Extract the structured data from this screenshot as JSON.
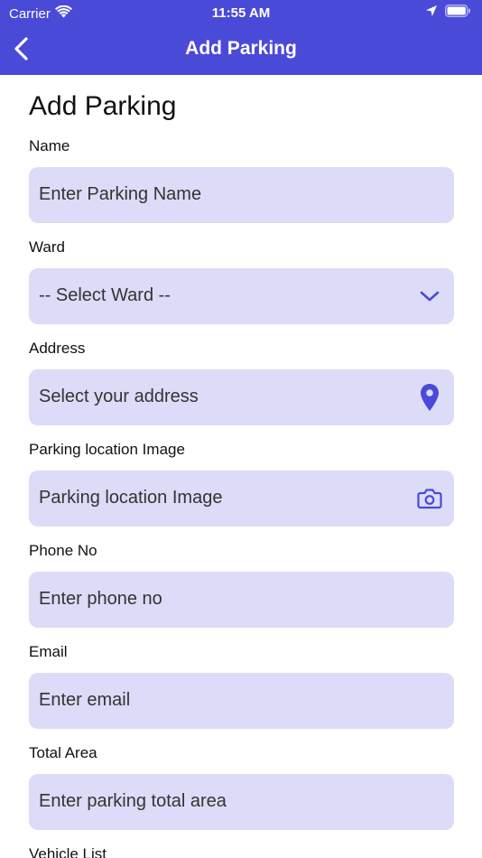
{
  "status_bar": {
    "carrier": "Carrier",
    "time": "11:55 AM"
  },
  "nav": {
    "title": "Add Parking"
  },
  "page": {
    "title": "Add Parking"
  },
  "form": {
    "fields": [
      {
        "label": "Name",
        "placeholder": "Enter Parking Name"
      },
      {
        "label": "Ward",
        "placeholder": "-- Select Ward --",
        "icon": "chevron-down-icon"
      },
      {
        "label": "Address",
        "placeholder": "Select your address",
        "icon": "location-pin-icon"
      },
      {
        "label": "Parking location Image",
        "placeholder": "Parking location Image",
        "icon": "camera-icon"
      },
      {
        "label": "Phone No",
        "placeholder": "Enter phone no"
      },
      {
        "label": "Email",
        "placeholder": "Enter email"
      },
      {
        "label": "Total Area",
        "placeholder": "Enter parking total area"
      },
      {
        "label": "Vehicle List"
      }
    ]
  },
  "colors": {
    "accent": "#4a4ad9",
    "field_background": "#dcdcf8",
    "icon": "#4a4ad9"
  }
}
